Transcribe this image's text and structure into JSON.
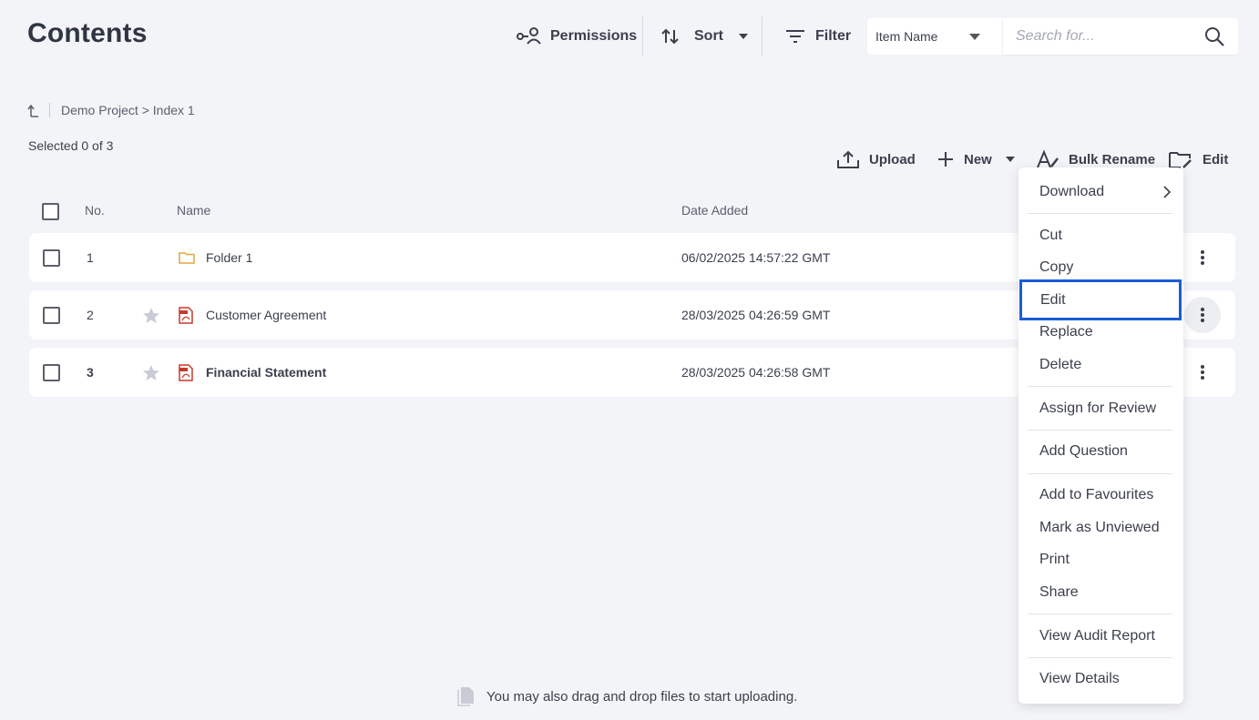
{
  "page": {
    "title": "Contents"
  },
  "toolbar": {
    "permissions_label": "Permissions",
    "sort_label": "Sort",
    "filter_label": "Filter",
    "search_field_selected": "Item Name",
    "search_placeholder": "Search for..."
  },
  "breadcrumb": {
    "path": "Demo Project > Index 1"
  },
  "selection": {
    "text": "Selected 0 of 3"
  },
  "actions": {
    "upload_label": "Upload",
    "new_label": "New",
    "bulk_rename_label": "Bulk Rename",
    "edit_label": "Edit"
  },
  "table": {
    "headers": {
      "no": "No.",
      "name": "Name",
      "date_added": "Date Added"
    },
    "rows": [
      {
        "no": "1",
        "name": "Folder 1",
        "date": "06/02/2025 14:57:22 GMT",
        "type": "folder-icon",
        "bold": false
      },
      {
        "no": "2",
        "name": "Customer Agreement",
        "date": "28/03/2025 04:26:59 GMT",
        "type": "pdf-icon",
        "bold": false
      },
      {
        "no": "3",
        "name": "Financial Statement",
        "date": "28/03/2025 04:26:58 GMT",
        "type": "pdf-icon",
        "bold": true
      }
    ]
  },
  "context_menu": {
    "items": [
      {
        "label": "Download"
      },
      {
        "label": "Cut"
      },
      {
        "label": "Copy"
      },
      {
        "label": "Edit"
      },
      {
        "label": "Replace"
      },
      {
        "label": "Delete"
      },
      {
        "label": "Assign for Review"
      },
      {
        "label": "Add Question"
      },
      {
        "label": "Add to Favourites"
      },
      {
        "label": "Mark as Unviewed"
      },
      {
        "label": "Print"
      },
      {
        "label": "Share"
      },
      {
        "label": "View Audit Report"
      },
      {
        "label": "View Details"
      }
    ],
    "highlight_color": "#1a5cd7"
  },
  "footer": {
    "drag_drop_text": "You may also drag and drop files to start uploading."
  },
  "colors": {
    "background": "#f3f4f8",
    "folder": "#e0a93b",
    "pdf": "#c73a2b",
    "star": "#c9ccd4"
  }
}
